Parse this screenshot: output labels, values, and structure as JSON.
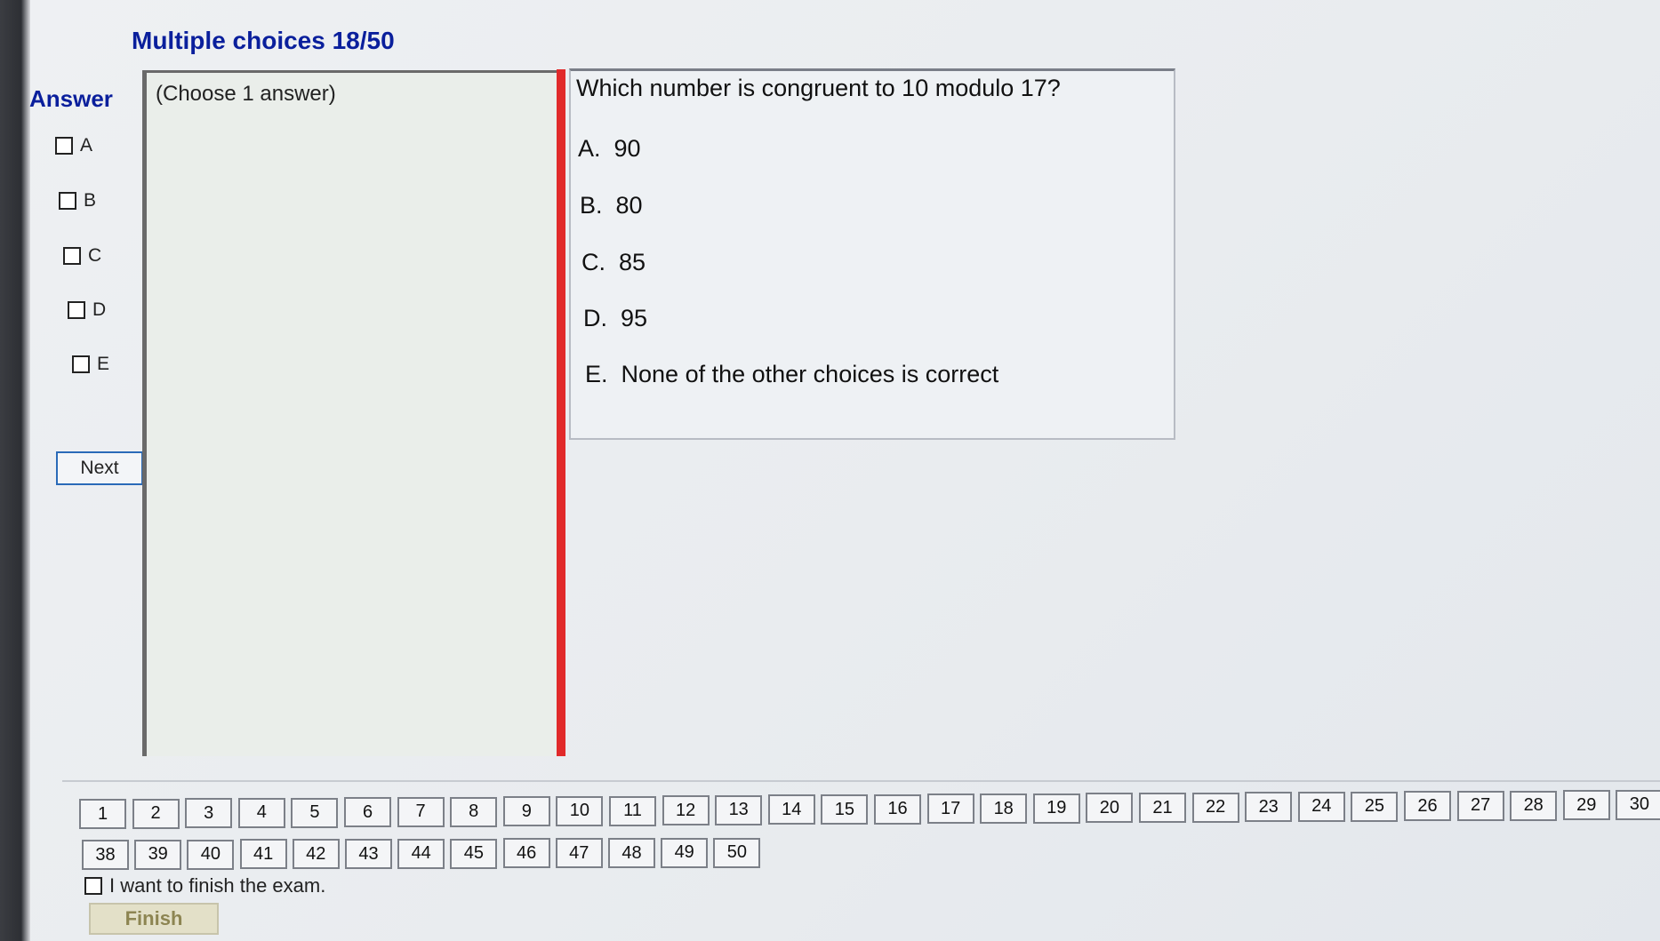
{
  "header": {
    "title": "Multiple choices 18/50"
  },
  "answer_panel": {
    "heading": "Answer",
    "options": [
      {
        "label": "A",
        "checked": false
      },
      {
        "label": "B",
        "checked": false
      },
      {
        "label": "C",
        "checked": false
      },
      {
        "label": "D",
        "checked": false
      },
      {
        "label": "E",
        "checked": false
      }
    ],
    "next_label": "Next"
  },
  "instructions": {
    "hint": "(Choose 1 answer)"
  },
  "question": {
    "text": "Which number is congruent to 10 modulo 17?",
    "choices": [
      {
        "letter": "A.",
        "text": "90"
      },
      {
        "letter": "B.",
        "text": "80"
      },
      {
        "letter": "C.",
        "text": "85"
      },
      {
        "letter": "D.",
        "text": "95"
      },
      {
        "letter": "E.",
        "text": "None of the other choices is correct"
      }
    ]
  },
  "navigation": {
    "row1": [
      "1",
      "2",
      "3",
      "4",
      "5",
      "6",
      "7",
      "8",
      "9",
      "10",
      "11",
      "12",
      "13",
      "14",
      "15",
      "16",
      "17",
      "18",
      "19",
      "20",
      "21",
      "22",
      "23",
      "24",
      "25",
      "26",
      "27",
      "28",
      "29",
      "30"
    ],
    "row2": [
      "38",
      "39",
      "40",
      "41",
      "42",
      "43",
      "44",
      "45",
      "46",
      "47",
      "48",
      "49",
      "50"
    ]
  },
  "finish": {
    "checkbox_label": "I want to finish the exam.",
    "checked": false,
    "button_label": "Finish"
  },
  "colors": {
    "heading_blue": "#0a1f9c",
    "divider_red": "#e12a2a",
    "finish_disabled": "#8d8552"
  }
}
